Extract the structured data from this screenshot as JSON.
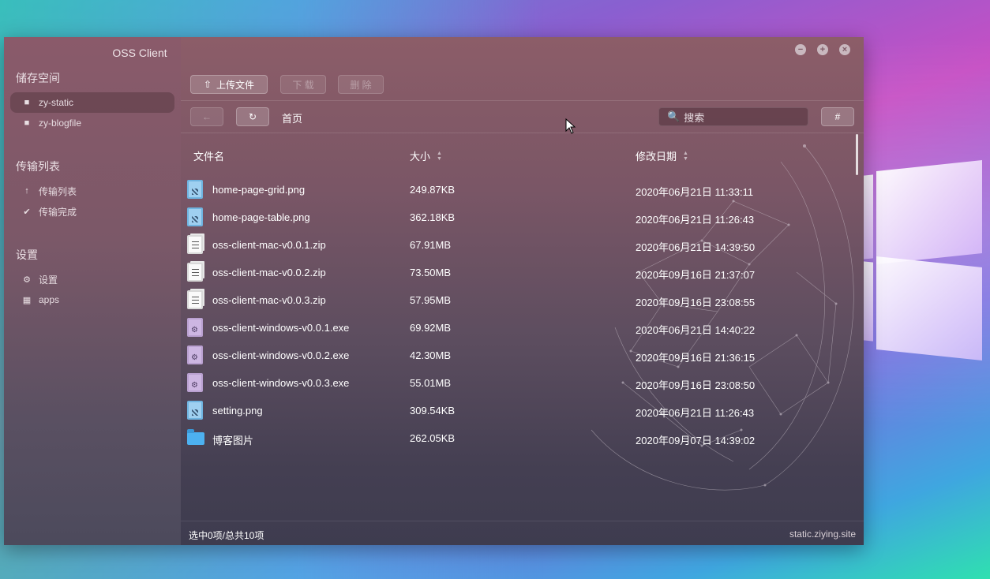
{
  "app": {
    "title": "OSS Client",
    "site": "static.ziying.site"
  },
  "sidebar": {
    "storage_title": "储存空间",
    "buckets": [
      {
        "label": "zy-static",
        "icon": "folder-icon",
        "active": true
      },
      {
        "label": "zy-blogfile",
        "icon": "folder-icon",
        "active": false
      }
    ],
    "transfer_title": "传输列表",
    "transfer_items": [
      {
        "label": "传输列表",
        "icon": "arrow-up-icon"
      },
      {
        "label": "传输完成",
        "icon": "check-circle-icon"
      }
    ],
    "settings_title": "设置",
    "settings_items": [
      {
        "label": "设置",
        "icon": "gear-icon"
      },
      {
        "label": "apps",
        "icon": "apps-grid-icon"
      }
    ]
  },
  "toolbar": {
    "upload_label": "上传文件",
    "download_label": "下 载",
    "delete_label": "删 除"
  },
  "nav": {
    "breadcrumb": "首页",
    "search_placeholder": "搜索"
  },
  "table": {
    "columns": {
      "name": "文件名",
      "size": "大小",
      "date": "修改日期"
    },
    "rows": [
      {
        "type": "image",
        "name": "home-page-grid.png",
        "size": "249.87KB",
        "date": "2020年06月21日 11:33:11"
      },
      {
        "type": "image",
        "name": "home-page-table.png",
        "size": "362.18KB",
        "date": "2020年06月21日 11:26:43"
      },
      {
        "type": "zip",
        "name": "oss-client-mac-v0.0.1.zip",
        "size": "67.91MB",
        "date": "2020年06月21日 14:39:50"
      },
      {
        "type": "zip",
        "name": "oss-client-mac-v0.0.2.zip",
        "size": "73.50MB",
        "date": "2020年09月16日 21:37:07"
      },
      {
        "type": "zip",
        "name": "oss-client-mac-v0.0.3.zip",
        "size": "57.95MB",
        "date": "2020年09月16日 23:08:55"
      },
      {
        "type": "exe",
        "name": "oss-client-windows-v0.0.1.exe",
        "size": "69.92MB",
        "date": "2020年06月21日 14:40:22"
      },
      {
        "type": "exe",
        "name": "oss-client-windows-v0.0.2.exe",
        "size": "42.30MB",
        "date": "2020年09月16日 21:36:15"
      },
      {
        "type": "exe",
        "name": "oss-client-windows-v0.0.3.exe",
        "size": "55.01MB",
        "date": "2020年09月16日 23:08:50"
      },
      {
        "type": "image",
        "name": "setting.png",
        "size": "309.54KB",
        "date": "2020年06月21日 11:26:43"
      },
      {
        "type": "folder",
        "name": "博客图片",
        "size": "262.05KB",
        "date": "2020年09月07日 14:39:02"
      }
    ]
  },
  "status": {
    "selection": "选中0项/总共10项"
  }
}
